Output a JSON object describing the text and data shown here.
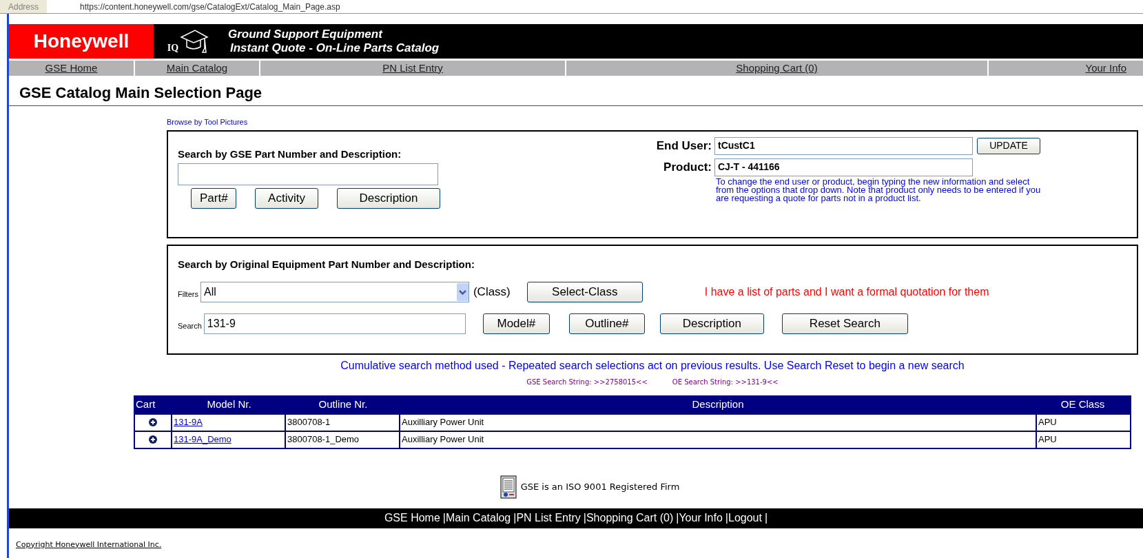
{
  "address_bar": {
    "label": "Address",
    "url": "https://content.honeywell.com/gse/CatalogExt/Catalog_Main_Page.asp"
  },
  "header": {
    "logo": "Honeywell",
    "badge": "IQ",
    "title": "Ground Support Equipment",
    "subtitle": "Instant Quote - On-Line Parts Catalog"
  },
  "nav": [
    "GSE Home",
    "Main Catalog",
    "PN List Entry",
    "Shopping Cart (0)",
    "Your Info"
  ],
  "page_title": "GSE Catalog Main Selection Page",
  "browse_link": "Browse by Tool Pictures",
  "gse_search": {
    "heading": "Search by GSE Part Number and Description:",
    "buttons": [
      "Part#",
      "Activity",
      "Description"
    ]
  },
  "customer": {
    "end_user_label": "End User:",
    "end_user": "tCustC1",
    "update_button": "UPDATE",
    "product_label": "Product:",
    "product": "CJ-T - 441166",
    "note": "To change the end user or product, begin typing the new information and select from the options that drop down. Note that product only needs to be entered if you are requesting a quote for parts not in a product list."
  },
  "oe_search": {
    "heading": "Search by Original Equipment Part Number and Description:",
    "filters_label": "Filters",
    "filter_value": "All",
    "class_label": "(Class)",
    "select_class_button": "Select-Class",
    "quote_link": "I have a list of parts and I want a formal quotation for them",
    "search_label": "Search",
    "search_value": "131-9",
    "buttons": [
      "Model#",
      "Outline#",
      "Description",
      "Reset Search"
    ]
  },
  "notice": "Cumulative search method used - Repeated search selections act on previous results. Use Search Reset to begin a new search",
  "gse_search_string": "GSE Search String: >>2758015<<",
  "oe_search_string": "OE Search String: >>131-9<<",
  "table": {
    "columns": [
      "Cart",
      "Model Nr.",
      "Outline Nr.",
      "Description",
      "OE Class"
    ],
    "rows": [
      {
        "model": "131-9A",
        "outline": "3800708-1",
        "description": "Auxilliary Power Unit",
        "oe_class": "APU"
      },
      {
        "model": "131-9A_Demo",
        "outline": "3800708-1_Demo",
        "description": "Auxilliary Power Unit",
        "oe_class": "APU"
      }
    ]
  },
  "iso_note": "GSE is an ISO 9001 Registered Firm",
  "footer_links": [
    "GSE Home",
    "Main Catalog",
    "PN List Entry",
    "Shopping Cart (0)",
    "Your Info",
    "Logout"
  ],
  "footer_separator": "|",
  "copyright": "Copyright Honeywell International Inc."
}
